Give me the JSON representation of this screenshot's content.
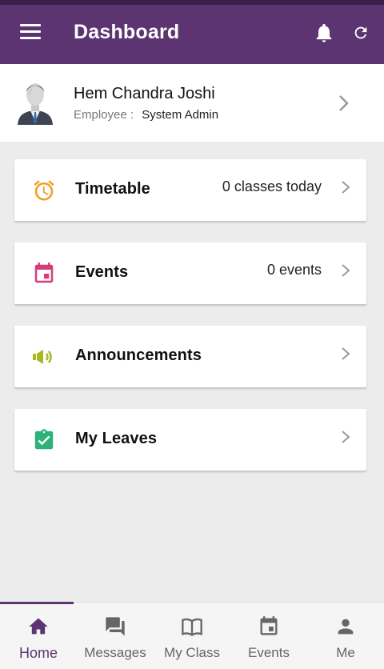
{
  "header": {
    "title": "Dashboard",
    "icons": [
      "menu-icon",
      "bell-icon",
      "refresh-icon"
    ]
  },
  "profile": {
    "name": "Hem Chandra Joshi",
    "role_label": "Employee :",
    "role_value": "System Admin"
  },
  "cards": [
    {
      "label": "Timetable",
      "meta": "0 classes today",
      "icon": "alarm-clock-icon",
      "color": "#f0a020"
    },
    {
      "label": "Events",
      "meta": "0 events",
      "icon": "calendar-icon",
      "color": "#d63d78"
    },
    {
      "label": "Announcements",
      "meta": "",
      "icon": "megaphone-icon",
      "color": "#a8b820"
    },
    {
      "label": "My Leaves",
      "meta": "",
      "icon": "clipboard-check-icon",
      "color": "#2db37a"
    }
  ],
  "bottom_nav": [
    {
      "label": "Home",
      "icon": "home-icon",
      "active": true
    },
    {
      "label": "Messages",
      "icon": "chat-icon",
      "active": false
    },
    {
      "label": "My Class",
      "icon": "book-icon",
      "active": false
    },
    {
      "label": "Events",
      "icon": "calendar-icon",
      "active": false
    },
    {
      "label": "Me",
      "icon": "person-icon",
      "active": false
    }
  ],
  "colors": {
    "primary": "#5c3472",
    "header_dark": "#3a1f4a",
    "background": "#ececec",
    "nav_inactive": "#666666"
  }
}
